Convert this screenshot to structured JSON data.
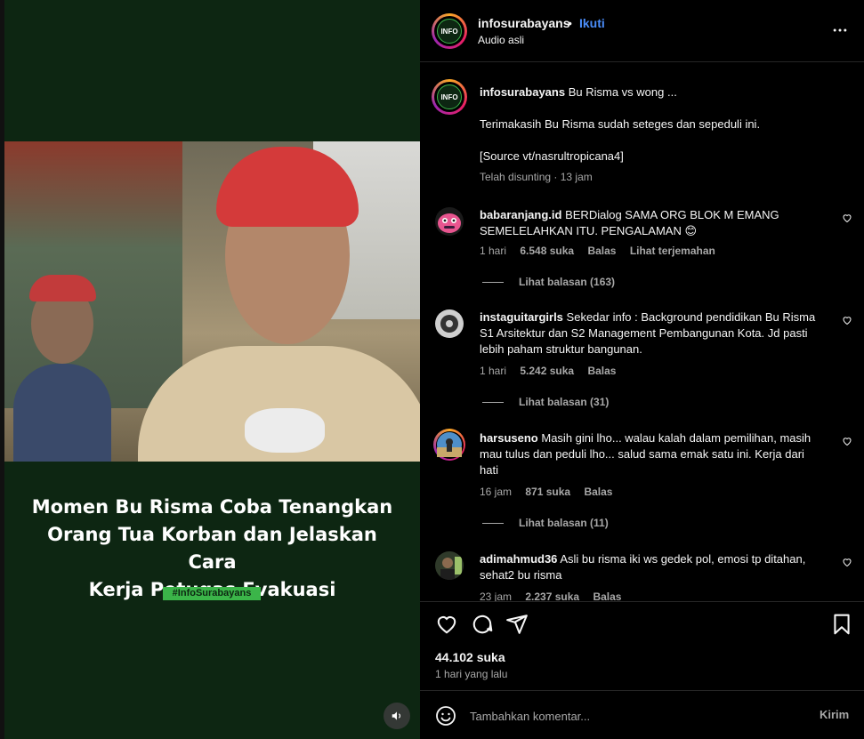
{
  "video": {
    "caption_line1": "Momen Bu Risma Coba Tenangkan",
    "caption_line2": "Orang Tua Korban dan Jelaskan Cara",
    "caption_line3": "Kerja Petugas Evakuasi",
    "tag": "#InfoSurabayans",
    "audio_icon": "speaker-icon",
    "bg_color": "#0d2612",
    "tag_color": "#3bb549"
  },
  "header": {
    "avatar_text": "INFO",
    "username": "infosurabayans",
    "separator": "•",
    "follow_label": "Ikuti",
    "audio_label": "Audio asli",
    "more_icon": "more-horizontal-icon"
  },
  "post_caption": {
    "username": "infosurabayans",
    "text1": "Bu Risma vs wong ...",
    "text2": "Terimakasih Bu Risma sudah seteges dan sepeduli ini.",
    "text3": "[Source vt/nasrultropicana4]",
    "meta": "Telah disunting · 13 jam"
  },
  "comments": [
    {
      "username": "babaranjang.id",
      "text": "BERDialog SAMA ORG BLOK M EMANG SEMELELAHKAN ITU. PENGALAMAN 😊",
      "time": "1 hari",
      "likes": "6.548 suka",
      "reply": "Balas",
      "translate": "Lihat terjemahan",
      "replies": "Lihat balasan (163)"
    },
    {
      "username": "instaguitargirls",
      "text": "Sekedar info : Background pendidikan Bu Risma S1 Arsitektur dan S2 Management Pembangunan Kota. Jd pasti lebih paham struktur bangunan.",
      "time": "1 hari",
      "likes": "5.242 suka",
      "reply": "Balas",
      "replies": "Lihat balasan (31)"
    },
    {
      "username": "harsuseno",
      "text": "Masih gini lho... walau kalah dalam pemilihan, masih mau tulus dan peduli lho... salud sama emak satu ini. Kerja dari hati",
      "time": "16 jam",
      "likes": "871 suka",
      "reply": "Balas",
      "replies": "Lihat balasan (11)"
    },
    {
      "username": "adimahmud36",
      "text": "Asli bu risma iki ws gedek pol, emosi tp ditahan, sehat2 bu risma",
      "time": "23 jam",
      "likes": "2.237 suka",
      "reply": "Balas"
    }
  ],
  "actions": {
    "like_icon": "heart-icon",
    "comment_icon": "comment-icon",
    "share_icon": "send-icon",
    "save_icon": "bookmark-icon",
    "likes": "44.102 suka",
    "posted": "1 hari yang lalu"
  },
  "composer": {
    "emoji_icon": "emoji-icon",
    "placeholder": "Tambahkan komentar...",
    "post_label": "Kirim"
  },
  "colors": {
    "accent": "#4a8df8",
    "muted": "#a8a8a8",
    "text": "#f5f5f5"
  }
}
